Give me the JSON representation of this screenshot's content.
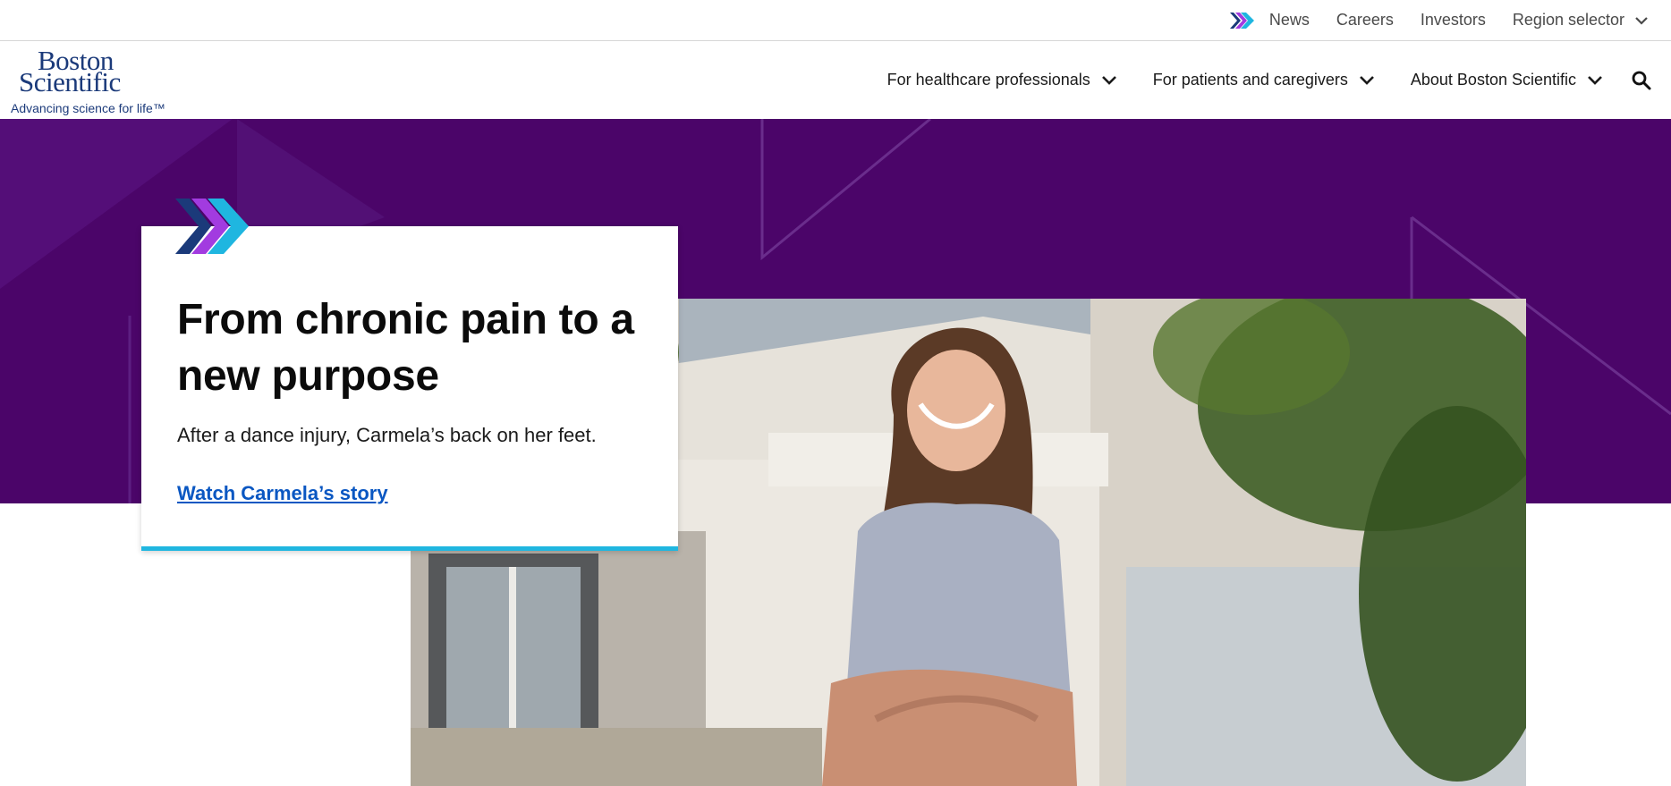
{
  "utility_nav": {
    "items": [
      {
        "label": "News"
      },
      {
        "label": "Careers"
      },
      {
        "label": "Investors"
      },
      {
        "label": "Region selector"
      }
    ]
  },
  "logo": {
    "line1": "Boston",
    "line2": "Scientific",
    "tagline": "Advancing science for life™"
  },
  "primary_nav": {
    "items": [
      {
        "label": "For healthcare professionals"
      },
      {
        "label": "For patients and caregivers"
      },
      {
        "label": "About Boston Scientific"
      }
    ],
    "search_icon": "search-icon"
  },
  "hero": {
    "title": "From chronic pain to a new purpose",
    "subtitle": "After a dance injury, Carmela’s back on her feet.",
    "link": "Watch Carmela’s story"
  },
  "colors": {
    "hero_band": "#4b0569",
    "brand_navy": "#1b3a7a",
    "link_blue": "#0a57c2",
    "accent_cyan": "#1fb6e0",
    "accent_purple": "#a23be0"
  }
}
